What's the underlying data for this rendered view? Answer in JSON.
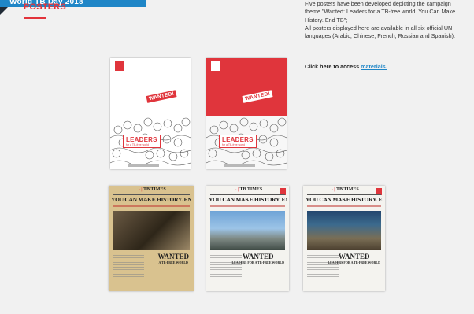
{
  "banner": {
    "text": "World TB Day 2018"
  },
  "section": {
    "title": "POSTERS"
  },
  "intro": {
    "line1": "Five posters have been developed depicting the campaign theme \"Wanted: Leaders for a TB-free world. You Can Make History. End TB\";",
    "line2": "All posters displayed here are available in all six official UN languages (Arabic, Chinese, French, Russian and Spanish)."
  },
  "access": {
    "prefix": "Click here to access ",
    "link": "materials."
  },
  "posters": {
    "p1": {
      "wanted": "WANTED!",
      "leaders": "LEADERS",
      "leaders_sub": "for a TB-free world"
    },
    "p2": {
      "wanted": "WANTED!",
      "leaders": "LEADERS",
      "leaders_sub": "for a TB-free world"
    },
    "p3": {
      "masthead": "TB TIMES",
      "headline": "YOU CAN MAKE HISTORY. END TB",
      "wanted": "WANTED",
      "wanted_sub": "A TB-FREE WORLD"
    },
    "p4": {
      "masthead": "TB TIMES",
      "headline": "YOU CAN MAKE HISTORY. END TB",
      "wanted": "WANTED",
      "wanted_sub": "LEADERS FOR A TB-FREE WORLD"
    },
    "p5": {
      "masthead": "TB TIMES",
      "headline": "YOU CAN MAKE HISTORY. END TB",
      "wanted": "WANTED",
      "wanted_sub": "LEADERS FOR A TB-FREE WORLD"
    }
  },
  "colors": {
    "accent_red": "#e2333b",
    "link_blue": "#1f86c7"
  }
}
